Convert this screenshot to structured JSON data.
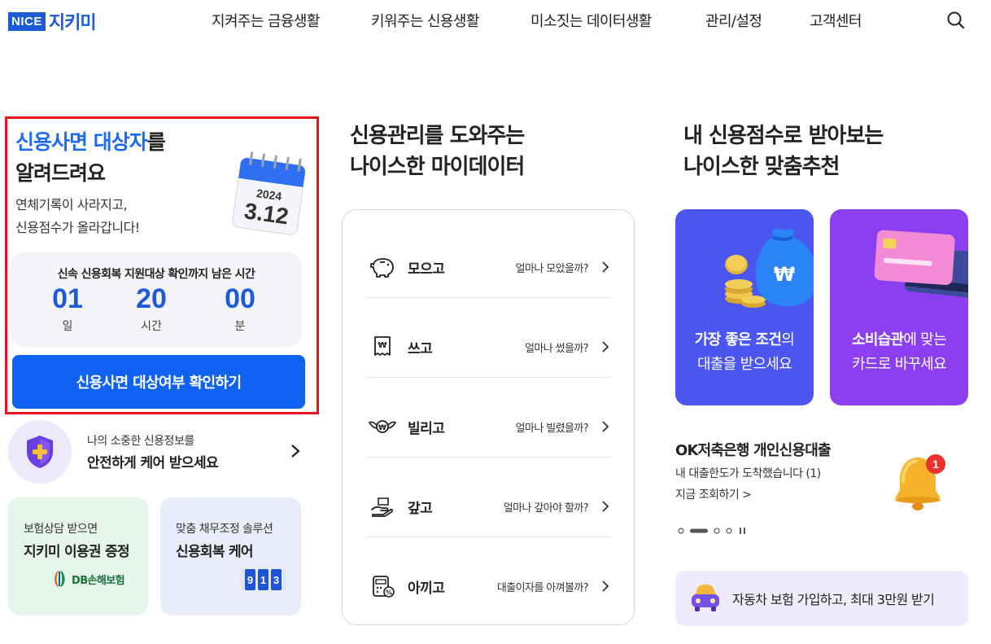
{
  "header": {
    "logo_badge": "NICE",
    "logo_name": "지키미",
    "nav": [
      "지켜주는 금융생활",
      "키워주는 신용생활",
      "미소짓는 데이터생활",
      "관리/설정",
      "고객센터"
    ]
  },
  "promo": {
    "title_highlight": "신용사면 대상자",
    "title_rest": "를",
    "title_line2": "알려드려요",
    "sub_line1": "연체기록이 사라지고,",
    "sub_line2": "신용점수가 올라갑니다!",
    "calendar_year": "2024",
    "calendar_date": "3.12",
    "timer_caption": "신속 신용회복 지원대상 확인까지 남은 시간",
    "timer": [
      {
        "value": "01",
        "unit": "일"
      },
      {
        "value": "20",
        "unit": "시간"
      },
      {
        "value": "00",
        "unit": "분"
      }
    ],
    "button": "신용사면 대상여부 확인하기"
  },
  "protect": {
    "small": "나의 소중한 신용정보를",
    "big": "안전하게 케어 받으세요"
  },
  "cards": {
    "green_small": "보험상담 받으면",
    "green_big": "지키미 이용권 증정",
    "green_brand": "DB손해보험",
    "blue_small": "맞춤 채무조정 솔루션",
    "blue_big": "신용회복 케어",
    "blue_counter": [
      "9",
      "1",
      "3"
    ]
  },
  "middle": {
    "heading_line1": "신용관리를 도와주는",
    "heading_line2": "나이스한 마이데이터",
    "rows": [
      {
        "label": "모으고",
        "desc": "얼마나 모았을까?",
        "icon": "piggy-bank-icon"
      },
      {
        "label": "쓰고",
        "desc": "얼마나 썼을까?",
        "icon": "receipt-icon"
      },
      {
        "label": "빌리고",
        "desc": "얼마나 빌렸을까?",
        "icon": "winged-coin-icon"
      },
      {
        "label": "갚고",
        "desc": "얼마나 갚아야 할까?",
        "icon": "hand-money-icon"
      },
      {
        "label": "아끼고",
        "desc": "대출이자를 아껴볼까?",
        "icon": "calculator-icon"
      }
    ]
  },
  "right": {
    "heading_line1": "내 신용점수로 받아보는",
    "heading_line2": "나이스한 맞춤추천",
    "rec_blue_bold": "가장 좋은 조건",
    "rec_blue_rest": "의",
    "rec_blue_line2": "대출을 받으세요",
    "rec_purple_bold": "소비습관",
    "rec_purple_rest": "에 맞는",
    "rec_purple_line2": "카드로 바꾸세요",
    "ad_title": "OK저축은행 개인신용대출",
    "ad_sub": "내 대출한도가 도착했습니다 (1)",
    "ad_link": "지금 조회하기 >",
    "bell_count": "1",
    "banner": "자동차 보험 가입하고, 최대 3만원 받기"
  },
  "colors": {
    "brand_blue": "#1f5bd6",
    "button_blue": "#1063f0",
    "highlight_red": "#e8141d",
    "rec_blue": "#4a56ef",
    "rec_purple": "#8b3ff1"
  }
}
